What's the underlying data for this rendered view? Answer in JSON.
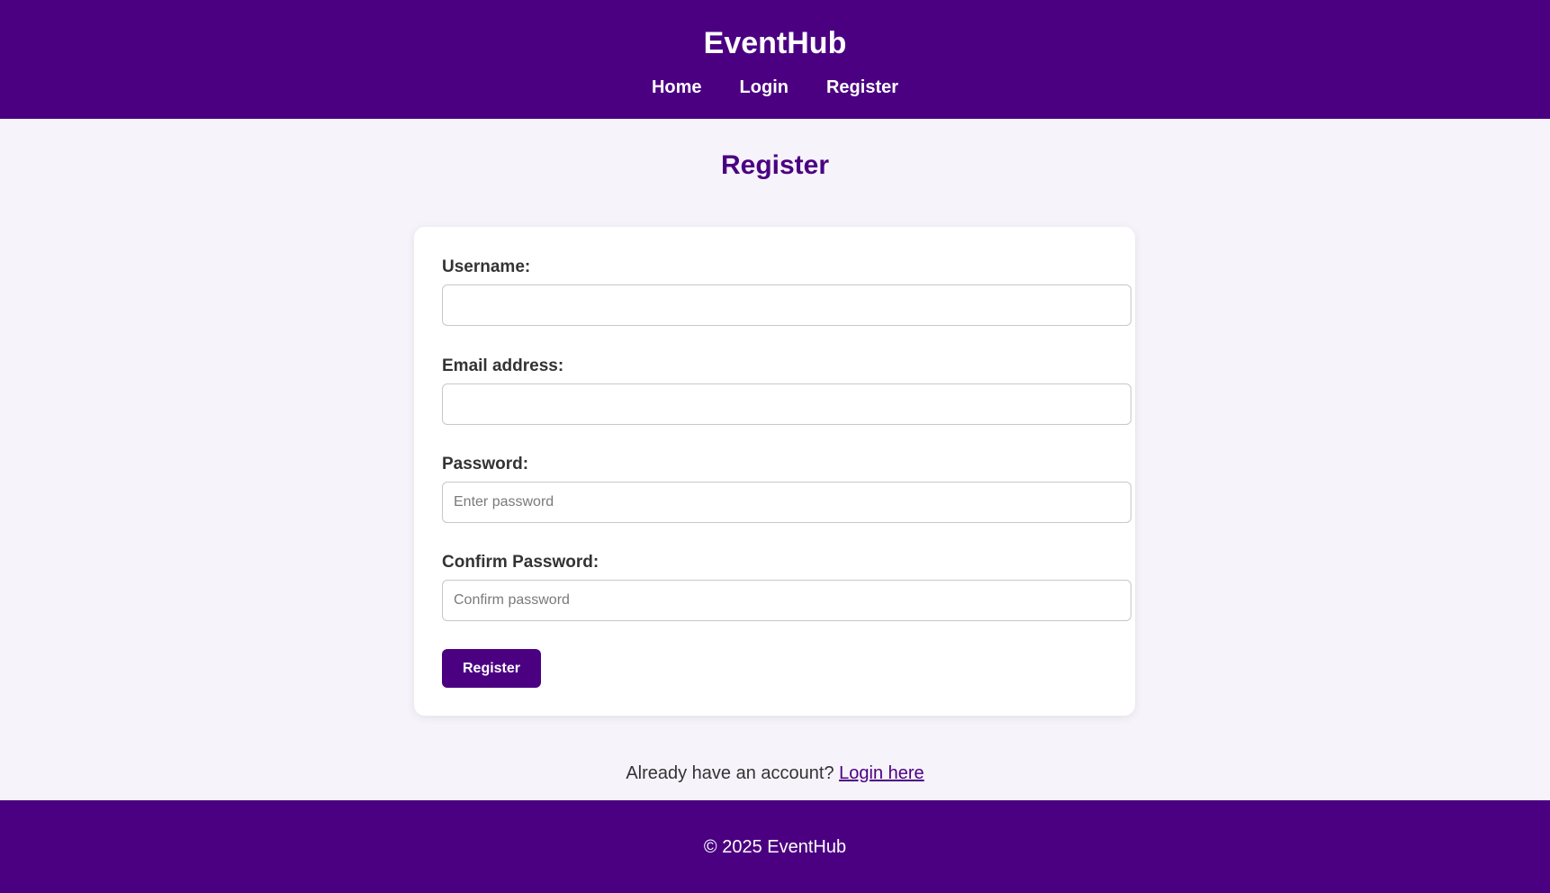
{
  "header": {
    "site_title": "EventHub",
    "nav": [
      {
        "label": "Home"
      },
      {
        "label": "Login"
      },
      {
        "label": "Register"
      }
    ]
  },
  "page": {
    "heading": "Register"
  },
  "form": {
    "username": {
      "label": "Username:",
      "value": "",
      "placeholder": ""
    },
    "email": {
      "label": "Email address:",
      "value": "",
      "placeholder": ""
    },
    "password": {
      "label": "Password:",
      "value": "",
      "placeholder": "Enter password"
    },
    "confirm_password": {
      "label": "Confirm Password:",
      "value": "",
      "placeholder": "Confirm password"
    },
    "submit_label": "Register"
  },
  "login_prompt": {
    "text": "Already have an account?",
    "link_label": "Login here"
  },
  "footer": {
    "text": "© 2025 EventHub"
  },
  "colors": {
    "brand": "#4b0082",
    "page_background": "#f6f3fa",
    "card_background": "#ffffff"
  }
}
